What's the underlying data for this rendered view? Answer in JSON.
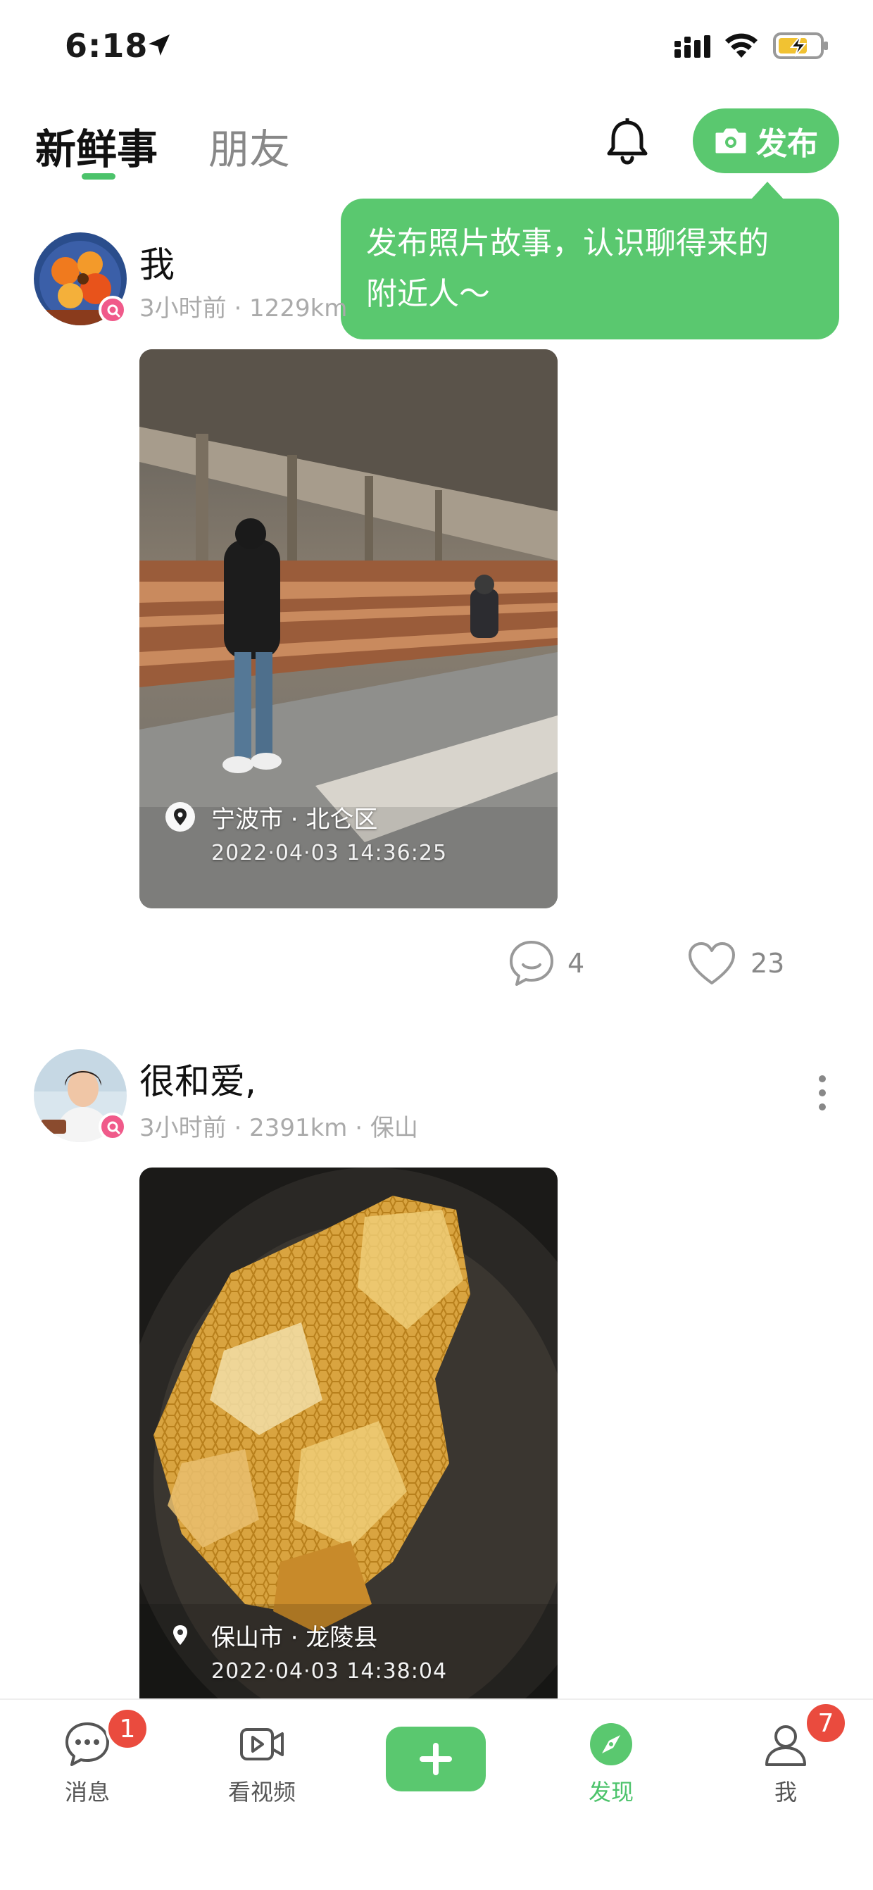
{
  "status_bar": {
    "time": "6:18"
  },
  "header": {
    "tabs": [
      {
        "label": "新鲜事",
        "active": true
      },
      {
        "label": "朋友",
        "active": false
      }
    ],
    "publish_label": "发布"
  },
  "tooltip": {
    "line1": "发布照片故事，认识聊得来的",
    "line2": "附近人～"
  },
  "posts": [
    {
      "name": "我",
      "meta": "3小时前 · 1229km",
      "location": "宁波市 · 北仑区",
      "timestamp": "2022·04·03  14:36:25",
      "comments": "4",
      "likes": "23"
    },
    {
      "name": "很和爱,",
      "meta": "3小时前 · 2391km · 保山",
      "location": "保山市 · 龙陵县",
      "timestamp": "2022·04·03  14:38:04"
    }
  ],
  "nav": {
    "items": [
      {
        "label": "消息",
        "icon": "message-icon",
        "badge": "1"
      },
      {
        "label": "看视频",
        "icon": "video-icon"
      },
      {
        "label": "",
        "icon": "plus-icon"
      },
      {
        "label": "发现",
        "icon": "compass-icon",
        "active": true
      },
      {
        "label": "我",
        "icon": "profile-icon",
        "badge": "7"
      }
    ]
  },
  "colors": {
    "accent": "#5ac86f",
    "badge": "#ea4b3e",
    "avatar_badge": "#f05a8a"
  }
}
